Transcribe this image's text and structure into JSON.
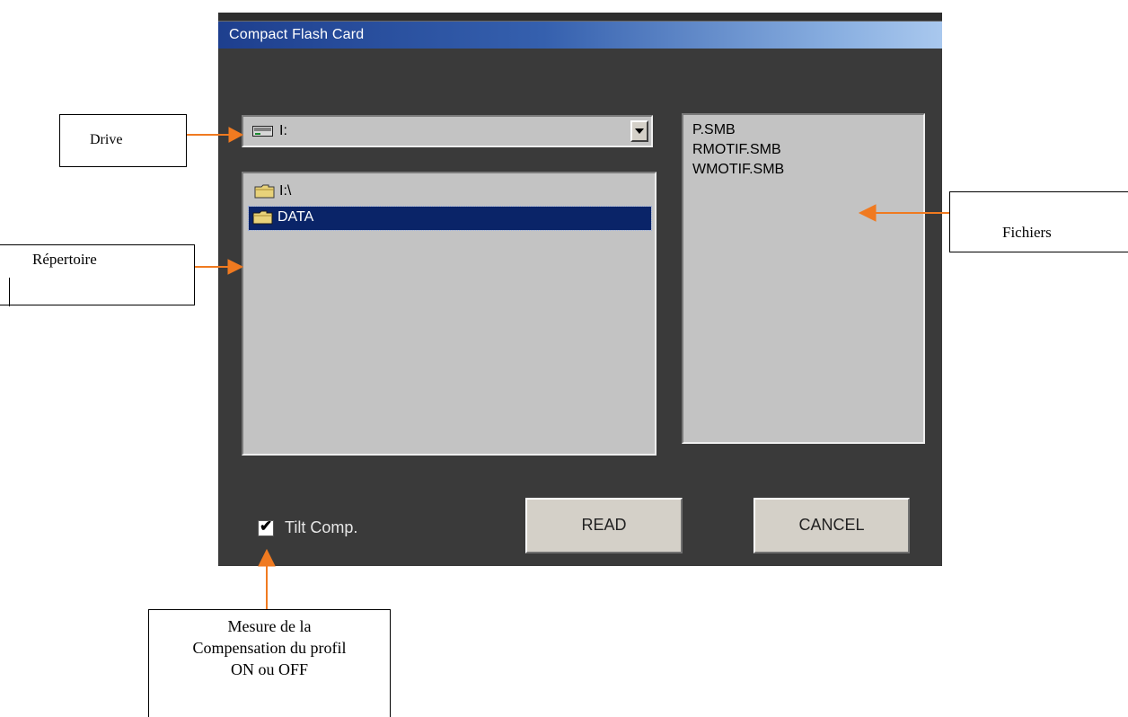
{
  "dialog": {
    "title": "Compact Flash Card",
    "drive_combo": {
      "value": "I:"
    },
    "tree": {
      "root_label": "I:\\",
      "selected_folder": "DATA"
    },
    "files": [
      "P.SMB",
      "RMOTIF.SMB",
      "WMOTIF.SMB"
    ],
    "tilt_checkbox": {
      "label": "Tilt Comp.",
      "checked": true
    },
    "read_button": "READ",
    "cancel_button": "CANCEL"
  },
  "annotations": {
    "drive": "Drive",
    "repertoire": "Répertoire",
    "fichiers": "Fichiers",
    "mesure_lines": [
      "Mesure de la",
      "Compensation du profil",
      "ON ou OFF"
    ]
  },
  "colors": {
    "arrow": "#f07a20",
    "selection": "#0a2468",
    "dialog_bg": "#3a3a3a",
    "panel_bg": "#c3c3c3"
  },
  "icons": {
    "drive": "drive-icon",
    "folder": "folder-icon",
    "dropdown": "chevron-down-icon"
  }
}
